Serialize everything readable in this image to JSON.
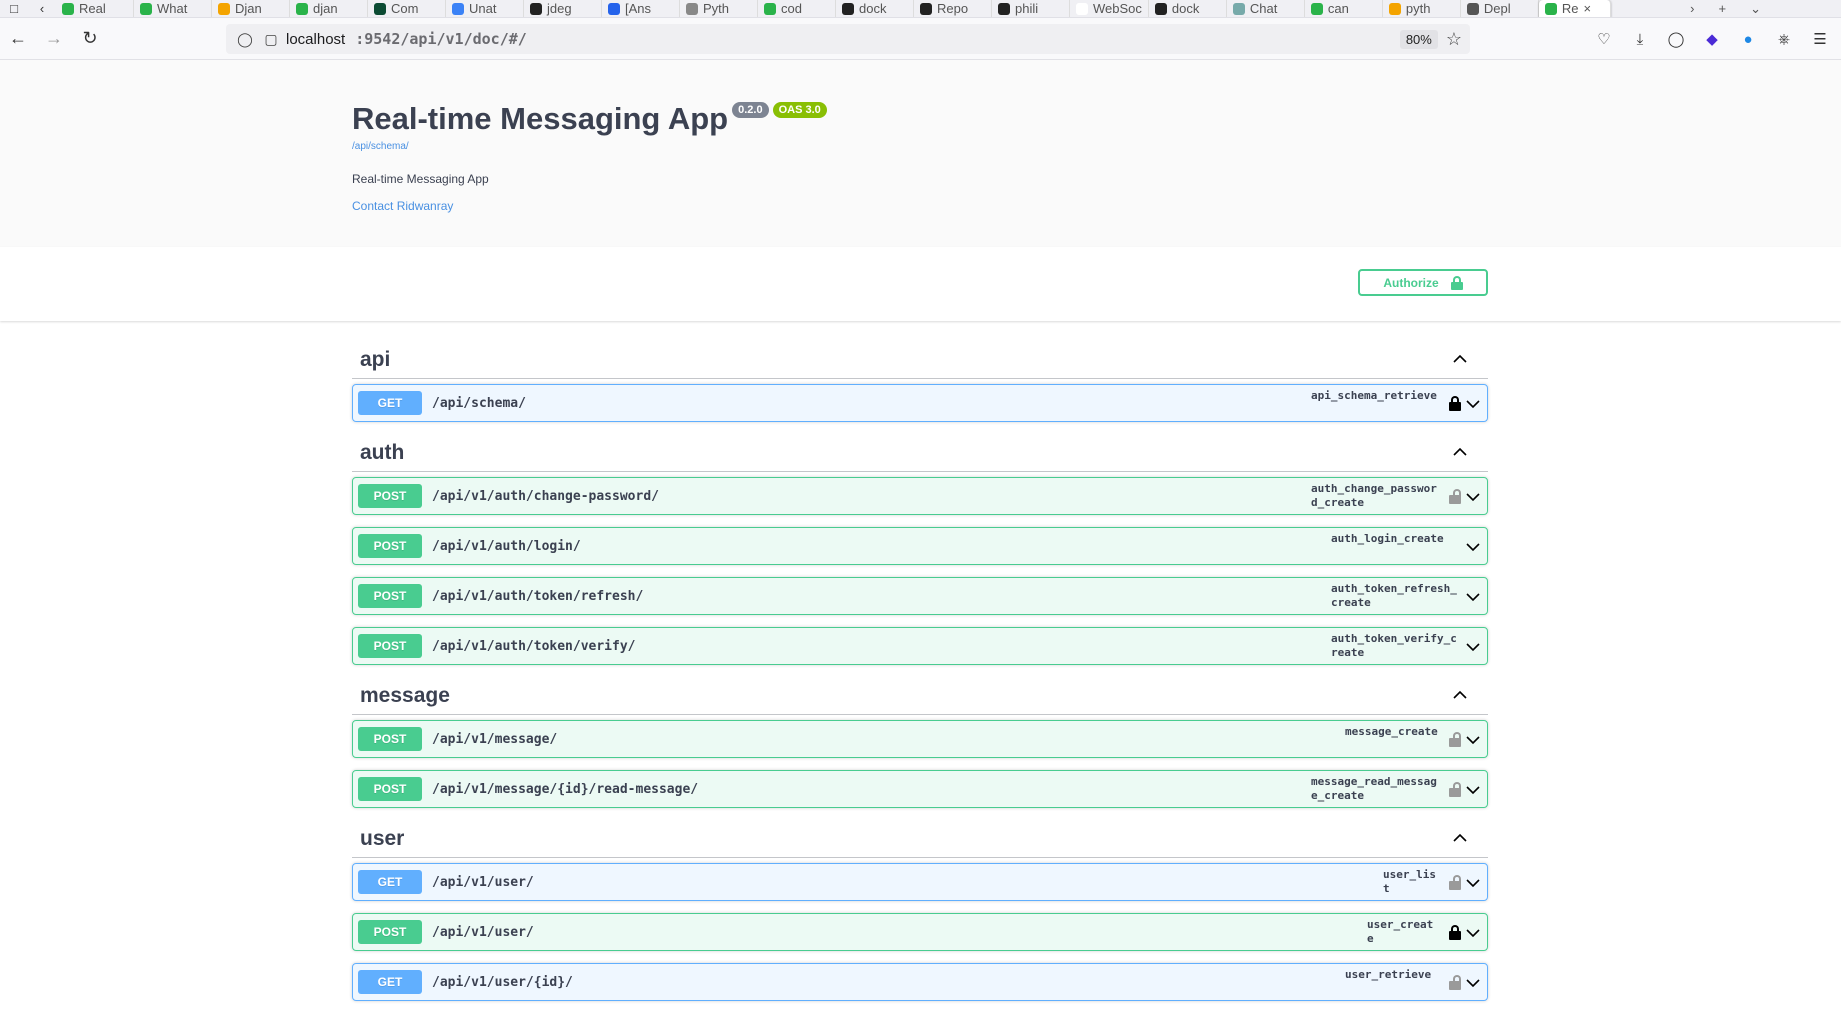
{
  "browser": {
    "tabs": [
      {
        "label": "Real",
        "color": "#2ab34a"
      },
      {
        "label": "What",
        "color": "#2ab34a"
      },
      {
        "label": "Djan",
        "color": "#f4a400"
      },
      {
        "label": "djan",
        "color": "#2ab34a"
      },
      {
        "label": "Com",
        "color": "#0c4b33"
      },
      {
        "label": "Unat",
        "color": "#3b82f6"
      },
      {
        "label": "jdeg",
        "color": "#222222"
      },
      {
        "label": "[Ans",
        "color": "#2563eb"
      },
      {
        "label": "Pyth",
        "color": "#888888"
      },
      {
        "label": "cod",
        "color": "#2ab34a"
      },
      {
        "label": "dock",
        "color": "#222222"
      },
      {
        "label": "Repo",
        "color": "#222222"
      },
      {
        "label": "phili",
        "color": "#222222"
      },
      {
        "label": "WebSoc",
        "color": "#ffffff"
      },
      {
        "label": "dock",
        "color": "#222222"
      },
      {
        "label": "Chat",
        "color": "#7aa"
      },
      {
        "label": "can",
        "color": "#2ab34a"
      },
      {
        "label": "pyth",
        "color": "#f4a400"
      },
      {
        "label": "Depl",
        "color": "#555555"
      },
      {
        "label": "Re",
        "color": "#2ab34a"
      }
    ],
    "url_host": "localhost",
    "url_path": ":9542/api/v1/doc/#/",
    "zoom": "80%"
  },
  "info": {
    "title": "Real-time Messaging App",
    "version": "0.2.0",
    "oas": "OAS 3.0",
    "schema_link": "/api/schema/",
    "description": "Real-time Messaging App",
    "contact": "Contact Ridwanray"
  },
  "authorize_label": "Authorize",
  "tags": [
    {
      "name": "api",
      "ops": [
        {
          "method": "GET",
          "path": "/api/schema/",
          "op_id": "api_schema_retrieve",
          "locked": true
        }
      ]
    },
    {
      "name": "auth",
      "ops": [
        {
          "method": "POST",
          "path": "/api/v1/auth/change-password/",
          "op_id": "auth_change_password_create",
          "locked": false
        },
        {
          "method": "POST",
          "path": "/api/v1/auth/login/",
          "op_id": "auth_login_create",
          "locked": null
        },
        {
          "method": "POST",
          "path": "/api/v1/auth/token/refresh/",
          "op_id": "auth_token_refresh_create",
          "locked": null
        },
        {
          "method": "POST",
          "path": "/api/v1/auth/token/verify/",
          "op_id": "auth_token_verify_create",
          "locked": null
        }
      ]
    },
    {
      "name": "message",
      "ops": [
        {
          "method": "POST",
          "path": "/api/v1/message/",
          "op_id": "message_create",
          "locked": false
        },
        {
          "method": "POST",
          "path": "/api/v1/message/{id}/read-message/",
          "op_id": "message_read_message_create",
          "locked": false
        }
      ]
    },
    {
      "name": "user",
      "ops": [
        {
          "method": "GET",
          "path": "/api/v1/user/",
          "op_id": "user_list",
          "locked": false
        },
        {
          "method": "POST",
          "path": "/api/v1/user/",
          "op_id": "user_create",
          "locked": true
        },
        {
          "method": "GET",
          "path": "/api/v1/user/{id}/",
          "op_id": "user_retrieve",
          "locked": false
        }
      ]
    }
  ]
}
